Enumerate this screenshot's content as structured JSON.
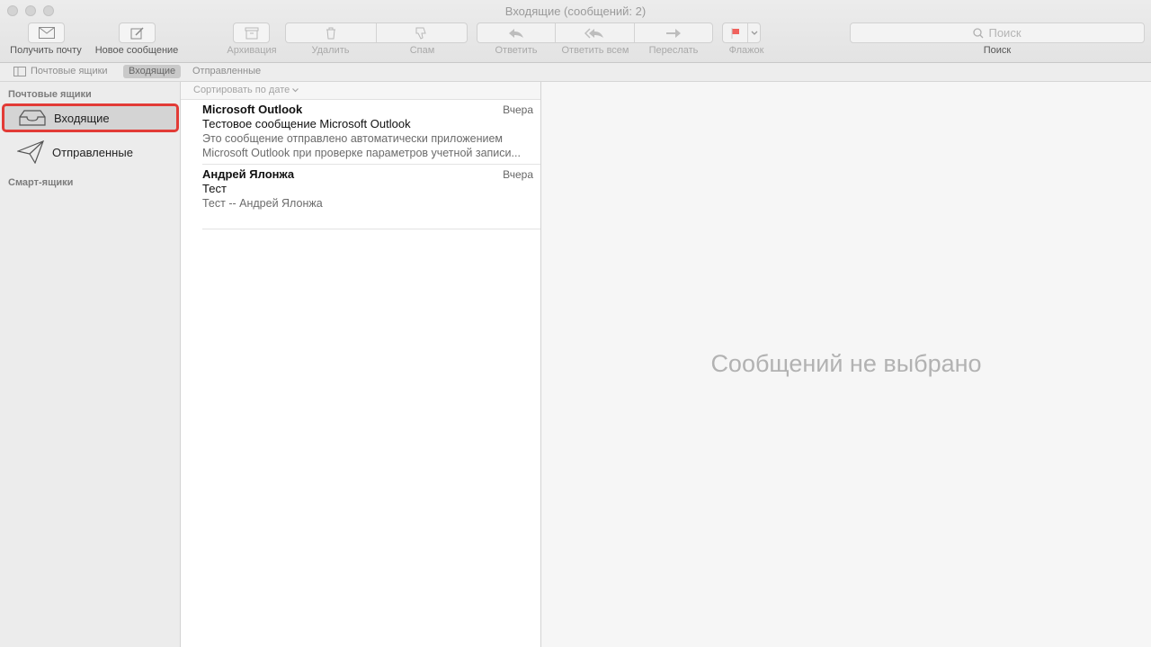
{
  "window": {
    "title": "Входящие (сообщений: 2)"
  },
  "toolbar": {
    "get_mail": "Получить почту",
    "new_message": "Новое сообщение",
    "archive": "Архивация",
    "delete": "Удалить",
    "junk": "Спам",
    "reply": "Ответить",
    "reply_all": "Ответить всем",
    "forward": "Переслать",
    "flag": "Флажок",
    "search_placeholder": "Поиск",
    "search_label": "Поиск",
    "flag_color": "#f0625d"
  },
  "favorites": {
    "mailboxes": "Почтовые ящики",
    "inbox": "Входящие",
    "sent": "Отправленные"
  },
  "sidebar": {
    "mailboxes_header": "Почтовые ящики",
    "items": [
      {
        "label": "Входящие",
        "icon": "inbox-tray-icon"
      },
      {
        "label": "Отправленные",
        "icon": "paper-plane-icon"
      }
    ],
    "smart_header": "Смарт-ящики",
    "highlight_color": "#e23b36"
  },
  "message_list": {
    "sort_label": "Сортировать по дате",
    "messages": [
      {
        "from": "Microsoft Outlook",
        "date": "Вчера",
        "subject": "Тестовое сообщение Microsoft Outlook",
        "preview1": "Это сообщение отправлено автоматически приложением",
        "preview2": "Microsoft Outlook при проверке параметров учетной записи..."
      },
      {
        "from": "Андрей Ялонжа",
        "date": "Вчера",
        "subject": "Тест",
        "preview1": "Тест -- Андрей Ялонжа"
      }
    ]
  },
  "preview": {
    "empty_text": "Сообщений не выбрано"
  }
}
